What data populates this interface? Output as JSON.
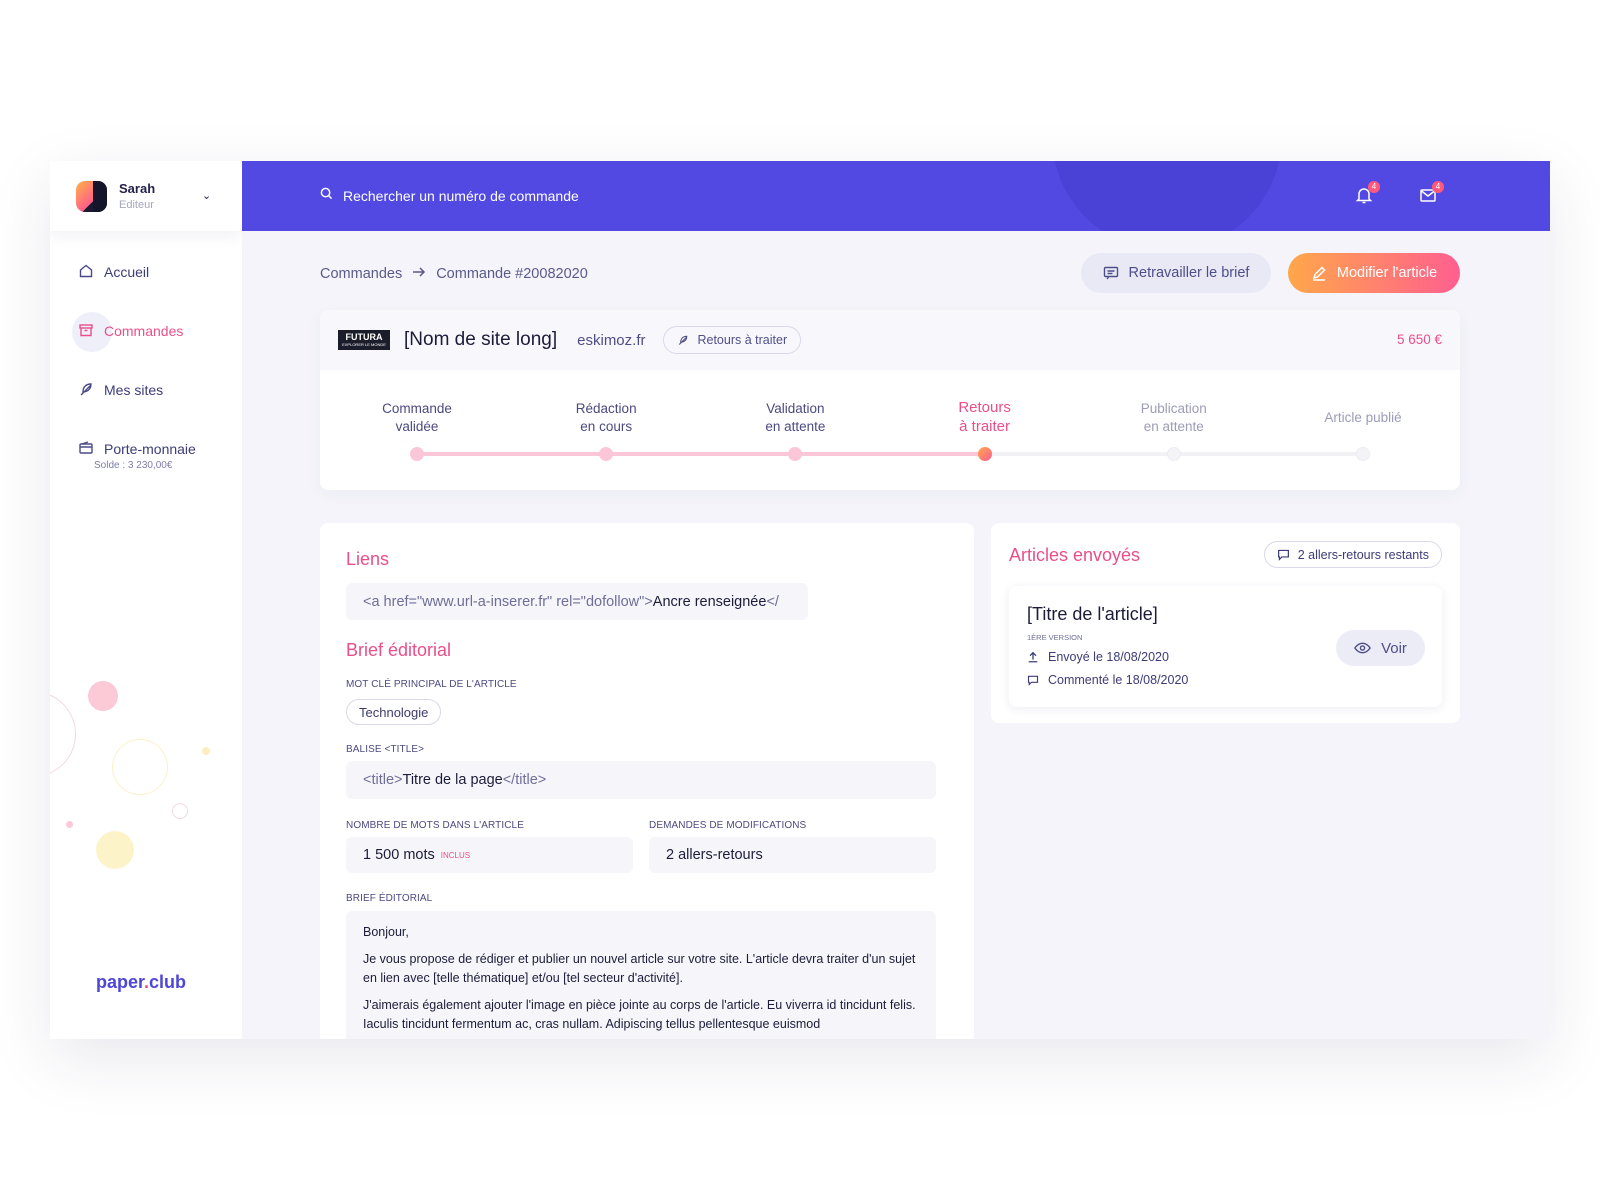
{
  "user": {
    "name": "Sarah",
    "role": "Editeur"
  },
  "sidebar": {
    "items": [
      {
        "label": "Accueil",
        "icon": "home-icon"
      },
      {
        "label": "Commandes",
        "icon": "archive-icon",
        "active": true
      },
      {
        "label": "Mes sites",
        "icon": "feather-icon"
      },
      {
        "label": "Porte-monnaie",
        "sub": "Solde : 3 230,00€",
        "icon": "wallet-icon"
      }
    ],
    "brand": {
      "name": "paper",
      "dot": ".",
      "suffix": "club"
    }
  },
  "topbar": {
    "search_placeholder": "Rechercher un numéro de commande",
    "notifications_count": "4",
    "messages_count": "4"
  },
  "breadcrumb": {
    "root": "Commandes",
    "current": "Commande #20082020"
  },
  "actions": {
    "rework_label": "Retravailler le brief",
    "edit_label": "Modifier l'article"
  },
  "order": {
    "logo": {
      "title": "FUTURA",
      "tagline": "EXPLORER LE MONDE"
    },
    "site_name": "[Nom de site long]",
    "domain": "eskimoz.fr",
    "status": "Retours à traiter",
    "price": "5 650 €",
    "progress": 0.6,
    "steps": [
      {
        "line1": "Commande",
        "line2": "validée"
      },
      {
        "line1": "Rédaction",
        "line2": "en cours"
      },
      {
        "line1": "Validation",
        "line2": "en attente"
      },
      {
        "line1": "Retours",
        "line2": "à traiter"
      },
      {
        "line1": "Publication",
        "line2": "en attente"
      },
      {
        "line1": "Article publié",
        "line2": ""
      }
    ],
    "current_step": 3
  },
  "links": {
    "title": "Liens",
    "code_open": "<a href=\"www.url-a-inserer.fr\" rel=\"dofollow\">",
    "anchor": "Ancre renseignée",
    "code_close": "</"
  },
  "brief": {
    "title": "Brief éditorial",
    "keyword_label": "MOT CLÉ PRINCIPAL DE L'ARTICLE",
    "keyword": "Technologie",
    "title_tag_label": "BALISE <TITLE>",
    "title_open": "<title>",
    "title_value": "Titre de la page",
    "title_close": "</title>",
    "words_label": "NOMBRE DE MOTS DANS L'ARTICLE",
    "words_value": "1 500 mots",
    "words_badge": "INCLUS",
    "mods_label": "DEMANDES DE MODIFICATIONS",
    "mods_value": "2 allers-retours",
    "brief_label": "BRIEF ÉDITORIAL",
    "paragraphs": [
      "Bonjour,",
      "Je vous propose de rédiger et publier un nouvel article sur votre site. L'article devra traiter d'un sujet en lien avec [telle thématique] et/ou [tel secteur d'activité].",
      "J'aimerais également ajouter l'image en pièce jointe au corps de l'article. Eu viverra id tincidunt felis. Iaculis tincidunt fermentum ac, cras nullam. Adipiscing tellus pellentesque euismod"
    ]
  },
  "articles": {
    "title": "Articles envoyés",
    "remaining": "2 allers-retours restants",
    "item": {
      "title": "[Titre de l'article]",
      "version": "1ÈRE VERSION",
      "sent": "Envoyé le 18/08/2020",
      "commented": "Commenté le 18/08/2020",
      "view_label": "Voir"
    }
  },
  "colors": {
    "primary": "#5149e2",
    "accent": "#e94f8b",
    "gradient_start": "#ffa74a",
    "gradient_end": "#ff5f8f"
  }
}
